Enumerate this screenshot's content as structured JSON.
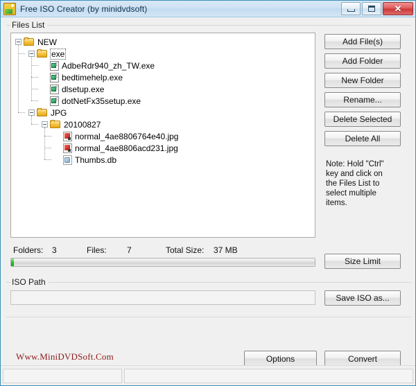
{
  "window": {
    "title": "Free ISO Creator (by minidvdsoft)",
    "app_icon": "iso-creator-icon",
    "controls": {
      "minimize": "minimize-icon",
      "maximize": "maximize-icon",
      "close": "close-icon",
      "close_glyph": "✕"
    },
    "accent_border": "#3a8fb7",
    "titlebar_color": "#cfe2f3"
  },
  "files_group": {
    "label": "Files List"
  },
  "tree": {
    "nodes": [
      {
        "label": "NEW",
        "type": "folder",
        "depth": 0,
        "expanded": true,
        "focused": false
      },
      {
        "label": "exe",
        "type": "folder",
        "depth": 1,
        "expanded": true,
        "focused": true
      },
      {
        "label": "AdbeRdr940_zh_TW.exe",
        "type": "exe",
        "depth": 2,
        "expanded": false,
        "focused": false
      },
      {
        "label": "bedtimehelp.exe",
        "type": "exe",
        "depth": 2,
        "expanded": false,
        "focused": false
      },
      {
        "label": "dlsetup.exe",
        "type": "exe",
        "depth": 2,
        "expanded": false,
        "focused": false
      },
      {
        "label": "dotNetFx35setup.exe",
        "type": "exe",
        "depth": 2,
        "expanded": false,
        "focused": false
      },
      {
        "label": "JPG",
        "type": "folder",
        "depth": 1,
        "expanded": true,
        "focused": false
      },
      {
        "label": "20100827",
        "type": "folder",
        "depth": 2,
        "expanded": true,
        "focused": false
      },
      {
        "label": "normal_4ae8806764e40.jpg",
        "type": "jpg",
        "depth": 3,
        "expanded": false,
        "focused": false
      },
      {
        "label": "normal_4ae8806acd231.jpg",
        "type": "jpg",
        "depth": 3,
        "expanded": false,
        "focused": false
      },
      {
        "label": "Thumbs.db",
        "type": "db",
        "depth": 3,
        "expanded": false,
        "focused": false
      }
    ]
  },
  "side_buttons": [
    {
      "label": "Add File(s)"
    },
    {
      "label": "Add Folder"
    },
    {
      "label": "New Folder"
    },
    {
      "label": "Rename..."
    },
    {
      "label": "Delete Selected"
    },
    {
      "label": "Delete All"
    }
  ],
  "note": {
    "text": "Note: Hold \"Ctrl\"\nkey and click on\nthe Files List to\nselect multiple\nitems."
  },
  "stats": {
    "folders_label": "Folders:",
    "folders_value": "3",
    "files_label": "Files:",
    "files_value": "7",
    "total_size_label": "Total Size:",
    "total_size_value": "37 MB"
  },
  "progress": {
    "percent": 1,
    "fill_color": "#27c327"
  },
  "size_limit_button": {
    "label": "Size Limit"
  },
  "iso_path": {
    "group_label": "ISO Path",
    "value": "",
    "placeholder": ""
  },
  "save_iso_button": {
    "label": "Save ISO as..."
  },
  "brand": {
    "text": "Www.MiniDVDSoft.Com",
    "color": "#8b1a1a"
  },
  "bottom_buttons": [
    {
      "label": "Options"
    },
    {
      "label": "Convert"
    }
  ],
  "statusbar": {
    "panel1": "",
    "panel2": ""
  }
}
